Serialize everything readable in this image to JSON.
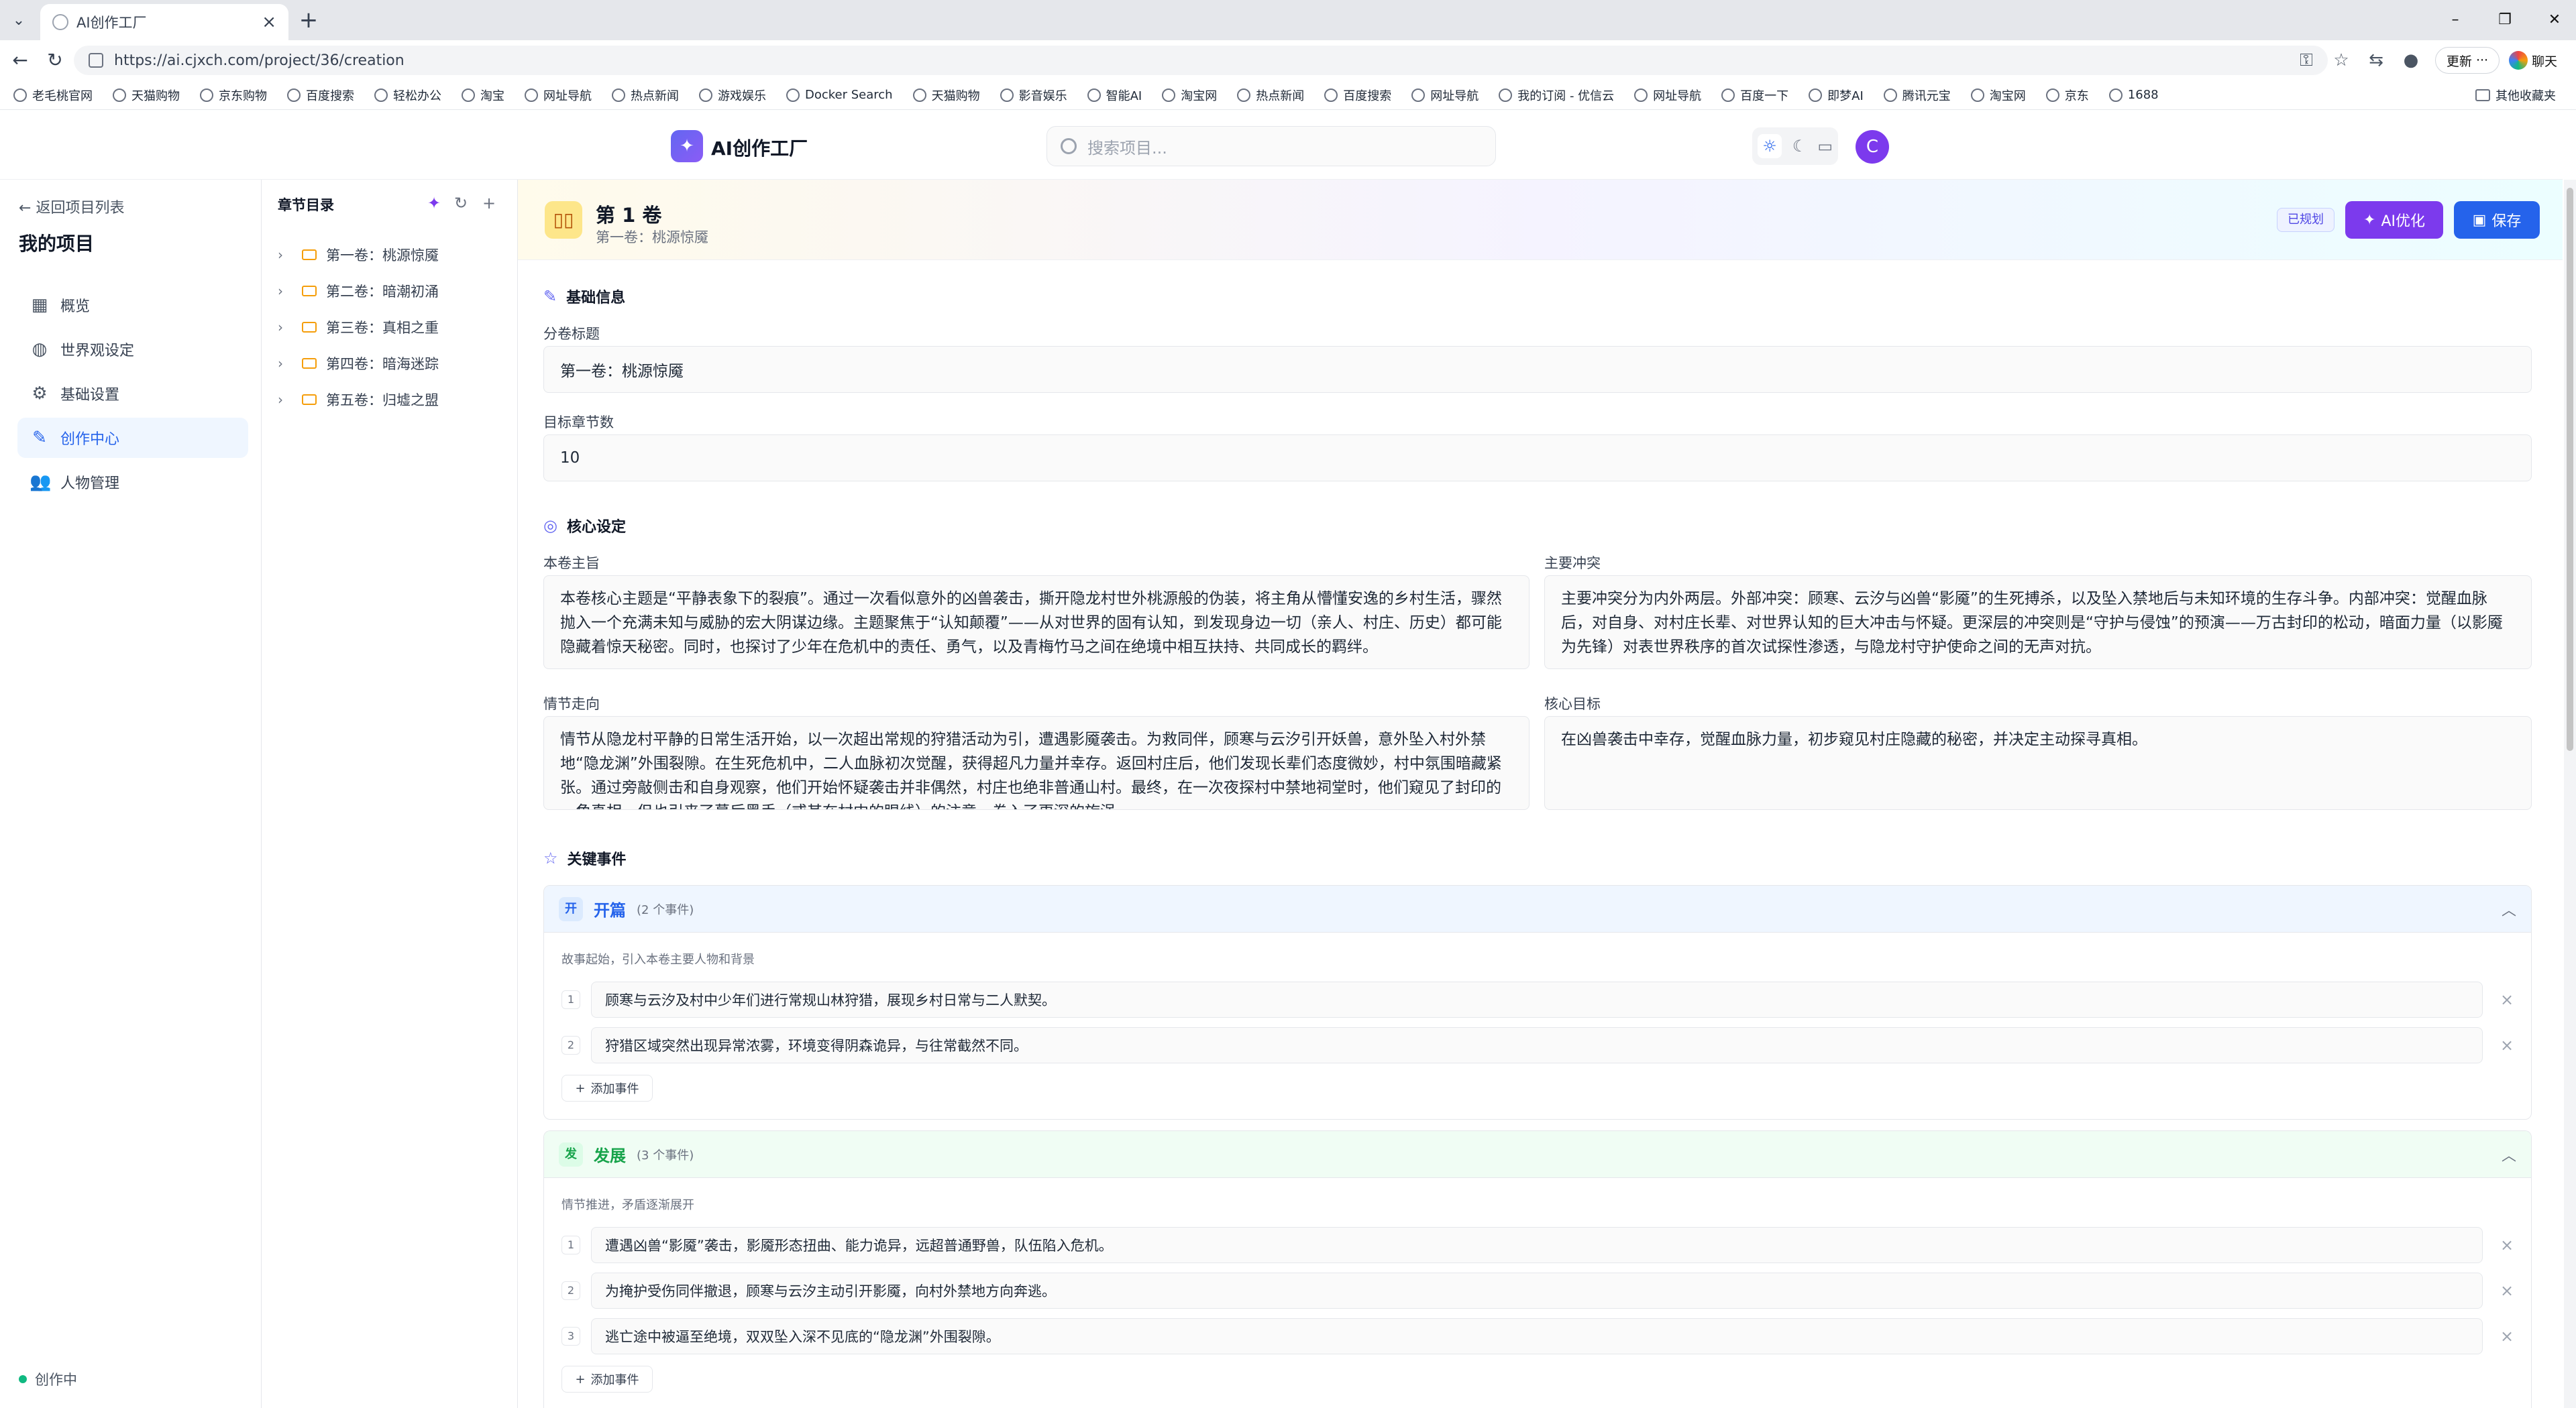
{
  "browser": {
    "tab_title": "AI创作工厂",
    "url": "https://ai.cjxch.com/project/36/creation",
    "update_label": "更新",
    "chat_label": "聊天",
    "bookmarks": [
      "老毛桃官网",
      "天猫购物",
      "京东购物",
      "百度搜索",
      "轻松办公",
      "淘宝",
      "网址导航",
      "热点新闻",
      "游戏娱乐",
      "Docker Search",
      "天猫购物",
      "影音娱乐",
      "智能AI",
      "淘宝网",
      "热点新闻",
      "百度搜索",
      "网址导航",
      "我的订阅 - 优信云",
      "网址导航",
      "百度一下",
      "即梦AI",
      "腾讯元宝",
      "淘宝网",
      "京东",
      "1688"
    ],
    "other_bookmarks": "其他收藏夹"
  },
  "app": {
    "title": "AI创作工厂",
    "search_placeholder": "搜索项目...",
    "avatar_letter": "C"
  },
  "sidebar": {
    "back_label": "返回项目列表",
    "project_title": "我的项目",
    "items": [
      {
        "label": "概览",
        "icon": "grid-icon"
      },
      {
        "label": "世界观设定",
        "icon": "globe-icon"
      },
      {
        "label": "基础设置",
        "icon": "gear-icon"
      },
      {
        "label": "创作中心",
        "icon": "pen-icon",
        "active": true
      },
      {
        "label": "人物管理",
        "icon": "users-icon"
      }
    ],
    "status": "创作中"
  },
  "chapters": {
    "title": "章节目录",
    "items": [
      "第一卷：桃源惊魇",
      "第二卷：暗潮初涌",
      "第三卷：真相之重",
      "第四卷：暗海迷踪",
      "第五卷：归墟之盟"
    ]
  },
  "volume": {
    "title": "第 1 卷",
    "subtitle": "第一卷：桃源惊魇",
    "status_badge": "已规划",
    "ai_button": "AI优化",
    "save_button": "保存"
  },
  "basic": {
    "section_title": "基础信息",
    "volume_title_label": "分卷标题",
    "volume_title_value": "第一卷：桃源惊魇",
    "target_chapters_label": "目标章节数",
    "target_chapters_value": "10"
  },
  "core": {
    "section_title": "核心设定",
    "theme_label": "本卷主旨",
    "theme_value": "本卷核心主题是“平静表象下的裂痕”。通过一次看似意外的凶兽袭击，撕开隐龙村世外桃源般的伪装，将主角从懵懂安逸的乡村生活，骤然抛入一个充满未知与威胁的宏大阴谋边缘。主题聚焦于“认知颠覆”——从对世界的固有认知，到发现身边一切（亲人、村庄、历史）都可能隐藏着惊天秘密。同时，也探讨了少年在危机中的责任、勇气，以及青梅竹马之间在绝境中相互扶持、共同成长的羁绊。",
    "conflict_label": "主要冲突",
    "conflict_value": "主要冲突分为内外两层。外部冲突：顾寒、云汐与凶兽“影魇”的生死搏杀，以及坠入禁地后与未知环境的生存斗争。内部冲突：觉醒血脉后，对自身、对村庄长辈、对世界认知的巨大冲击与怀疑。更深层的冲突则是“守护与侵蚀”的预演——万古封印的松动，暗面力量（以影魇为先锋）对表世界秩序的首次试探性渗透，与隐龙村守护使命之间的无声对抗。",
    "plot_label": "情节走向",
    "plot_value": "情节从隐龙村平静的日常生活开始，以一次超出常规的狩猎活动为引，遭遇影魇袭击。为救同伴，顾寒与云汐引开妖兽，意外坠入村外禁地“隐龙渊”外围裂隙。在生死危机中，二人血脉初次觉醒，获得超凡力量并幸存。返回村庄后，他们发现长辈们态度微妙，村中氛围暗藏紧张。通过旁敲侧击和自身观察，他们开始怀疑袭击并非偶然，村庄也绝非普通山村。最终，在一次夜探村中禁地祠堂时，他们窥见了封印的一角真相，但也引来了幕后黑手（或其在村中的眼线）的注意，卷入了更深的旋涡。",
    "goal_label": "核心目标",
    "goal_value": "在凶兽袭击中幸存，觉醒血脉力量，初步窥见村庄隐藏的秘密，并决定主动探寻真相。"
  },
  "events": {
    "section_title": "关键事件",
    "add_label": "添加事件",
    "stages": [
      {
        "badge": "开",
        "name": "开篇",
        "count": "(2 个事件)",
        "desc": "故事起始，引入本卷主要人物和背景",
        "color": "#2563eb",
        "bg": "#eff6ff",
        "items": [
          "顾寒与云汐及村中少年们进行常规山林狩猎，展现乡村日常与二人默契。",
          "狩猎区域突然出现异常浓雾，环境变得阴森诡异，与往常截然不同。"
        ]
      },
      {
        "badge": "发",
        "name": "发展",
        "count": "(3 个事件)",
        "desc": "情节推进，矛盾逐渐展开",
        "color": "#16a34a",
        "bg": "#f0fdf4",
        "items": [
          "遭遇凶兽“影魇”袭击，影魇形态扭曲、能力诡异，远超普通野兽，队伍陷入危机。",
          "为掩护受伤同伴撤退，顾寒与云汐主动引开影魇，向村外禁地方向奔逃。",
          "逃亡途中被逼至绝境，双双坠入深不见底的“隐龙渊”外围裂隙。"
        ]
      }
    ]
  }
}
